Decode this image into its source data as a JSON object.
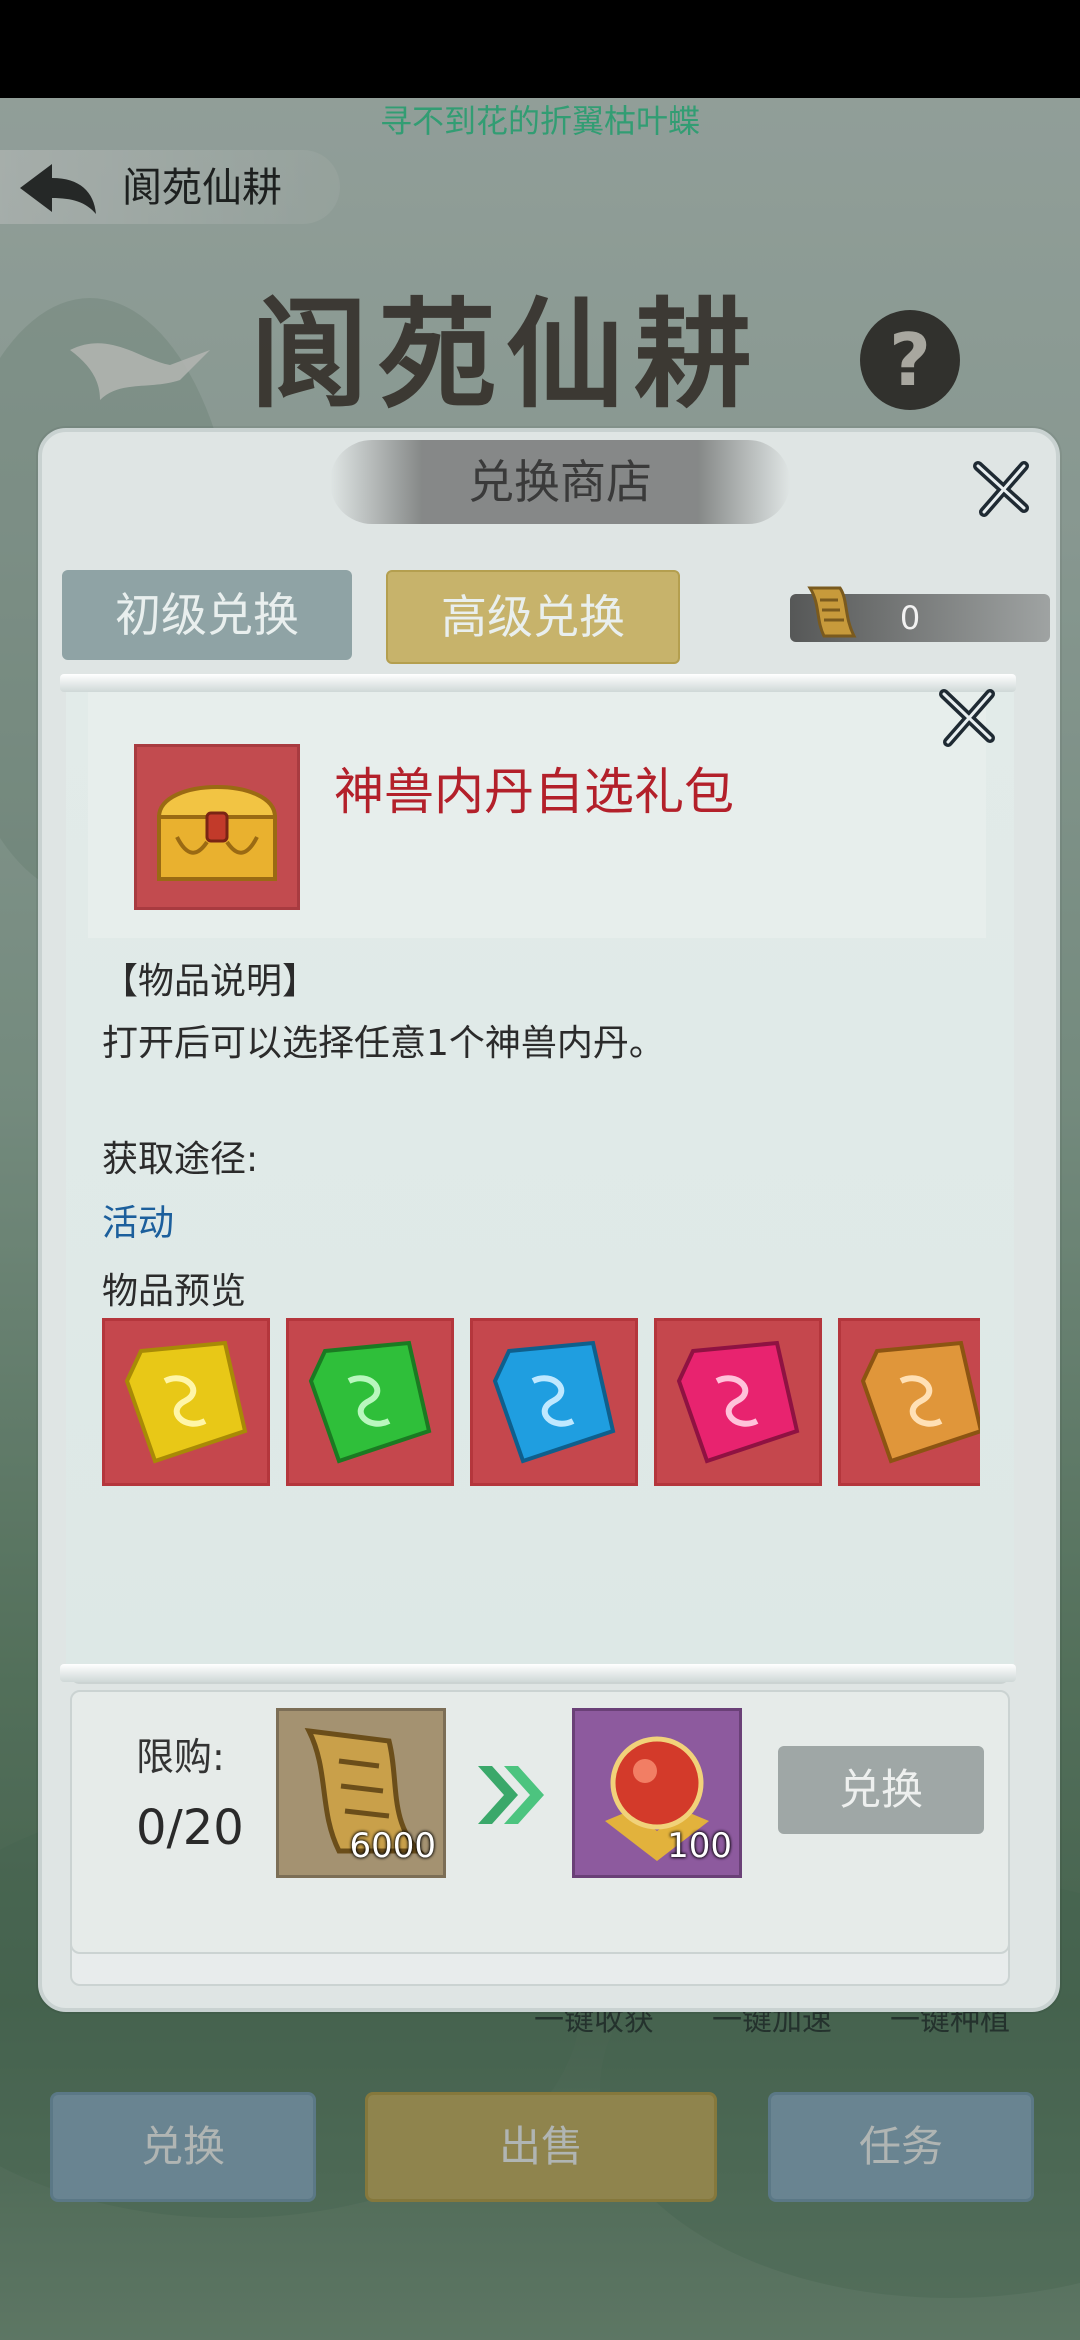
{
  "marquee": "寻不到花的折翼枯叶蝶",
  "top_bar": {
    "title": "阆苑仙耕"
  },
  "big_title": "阆苑仙耕",
  "help_label": "?",
  "shop": {
    "title": "兑换商店",
    "tabs": [
      "初级兑换",
      "高级兑换"
    ],
    "currency_value": "0",
    "row": {
      "limit_label": "限购:",
      "limit_value": "0/20",
      "cost_amount": "6000",
      "reward_amount": "100",
      "exchange_label": "兑换"
    }
  },
  "popup": {
    "item_name": "神兽内丹自选礼包",
    "desc_header": "【物品说明】",
    "desc_text": "打开后可以选择任意1个神兽内丹。",
    "source_header": "获取途径:",
    "source_text": "活动",
    "preview_header": "物品预览",
    "preview_gems": [
      {
        "name": "yellow-gem",
        "color": "#e8c817"
      },
      {
        "name": "green-gem",
        "color": "#2fbf3a"
      },
      {
        "name": "blue-gem",
        "color": "#1f9ee0"
      },
      {
        "name": "pink-gem",
        "color": "#e8236f"
      },
      {
        "name": "orange-gem",
        "color": "#e0963a"
      }
    ]
  },
  "quick_actions": [
    "一键收获",
    "一键加速",
    "一键种植"
  ],
  "bottom_buttons": {
    "exchange": "兑换",
    "sell": "出售",
    "task": "任务"
  }
}
